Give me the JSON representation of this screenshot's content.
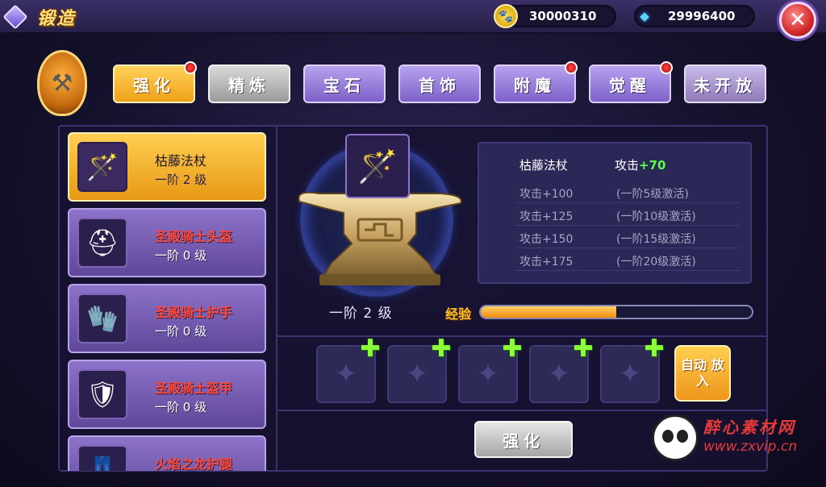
{
  "header": {
    "title": "锻造",
    "gold": "30000310",
    "gems": "29996400",
    "close_label": "✕"
  },
  "tabs": [
    {
      "label": "强化",
      "state": "active",
      "dot": true
    },
    {
      "label": "精炼",
      "state": "gray",
      "dot": false
    },
    {
      "label": "宝石",
      "state": "purple",
      "dot": false
    },
    {
      "label": "首饰",
      "state": "purple",
      "dot": false
    },
    {
      "label": "附魔",
      "state": "purple",
      "dot": true
    },
    {
      "label": "觉醒",
      "state": "purple",
      "dot": true
    },
    {
      "label": "未开放",
      "state": "lilac",
      "dot": false
    }
  ],
  "equipment": [
    {
      "name": "枯藤法杖",
      "level": "一阶 2 级",
      "selected": true,
      "icon": "staff-icon"
    },
    {
      "name": "圣殿骑士头盔",
      "level": "一阶 0 级",
      "selected": false,
      "icon": "helmet-icon"
    },
    {
      "name": "圣殿骑士护手",
      "level": "一阶 0 级",
      "selected": false,
      "icon": "gauntlet-icon"
    },
    {
      "name": "圣殿骑士盔甲",
      "level": "一阶 0 级",
      "selected": false,
      "icon": "armor-icon"
    },
    {
      "name": "火焰之龙护腿",
      "level": "",
      "selected": false,
      "icon": "leggings-icon"
    }
  ],
  "forge": {
    "current_level": "一阶 2 级",
    "exp_label": "经验",
    "exp_fraction": 0.5
  },
  "stats": {
    "item_name": "枯藤法杖",
    "current_prefix": "攻击",
    "current_value": "+70",
    "rows": [
      {
        "attr": "攻击+100",
        "cond": "(一阶5级激活)"
      },
      {
        "attr": "攻击+125",
        "cond": "(一阶10级激活)"
      },
      {
        "attr": "攻击+150",
        "cond": "(一阶15级激活)"
      },
      {
        "attr": "攻击+175",
        "cond": "(一阶20级激活)"
      }
    ]
  },
  "materials": {
    "slot_count": 5,
    "plus_label": "✚",
    "auto_fill_label": "自动 放入"
  },
  "actions": {
    "strengthen_label": "强化"
  },
  "watermark": {
    "line1": "醉心素材网",
    "line2": "www.zxvip.cn"
  },
  "colors": {
    "accent_gold": "#f0a118",
    "accent_purple": "#7d61c9",
    "bonus_green": "#5aff47",
    "item_name_red": "#ff4a3a"
  }
}
